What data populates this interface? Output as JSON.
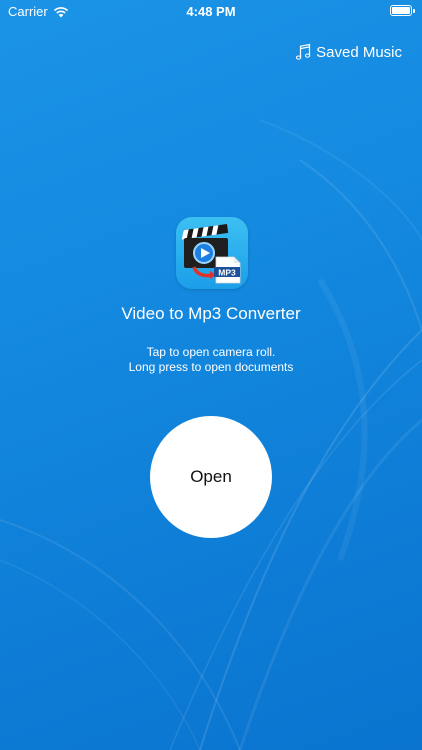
{
  "status_bar": {
    "carrier": "Carrier",
    "time": "4:48 PM",
    "icons": [
      "wifi-icon",
      "battery-icon"
    ]
  },
  "header": {
    "saved_music_label": "Saved Music",
    "saved_music_icon": "music-note-icon"
  },
  "app_icon": {
    "name": "video-to-mp3-app-icon",
    "badge_text": "MP3"
  },
  "main": {
    "title": "Video to Mp3 Converter",
    "hint_line1": "Tap to open camera roll.",
    "hint_line2": "Long press to open documents",
    "open_label": "Open"
  },
  "colors": {
    "background_top": "#1b93e6",
    "background_bottom": "#0a74cf",
    "text": "#ffffff",
    "button_bg": "#ffffff",
    "button_text": "#111111"
  }
}
